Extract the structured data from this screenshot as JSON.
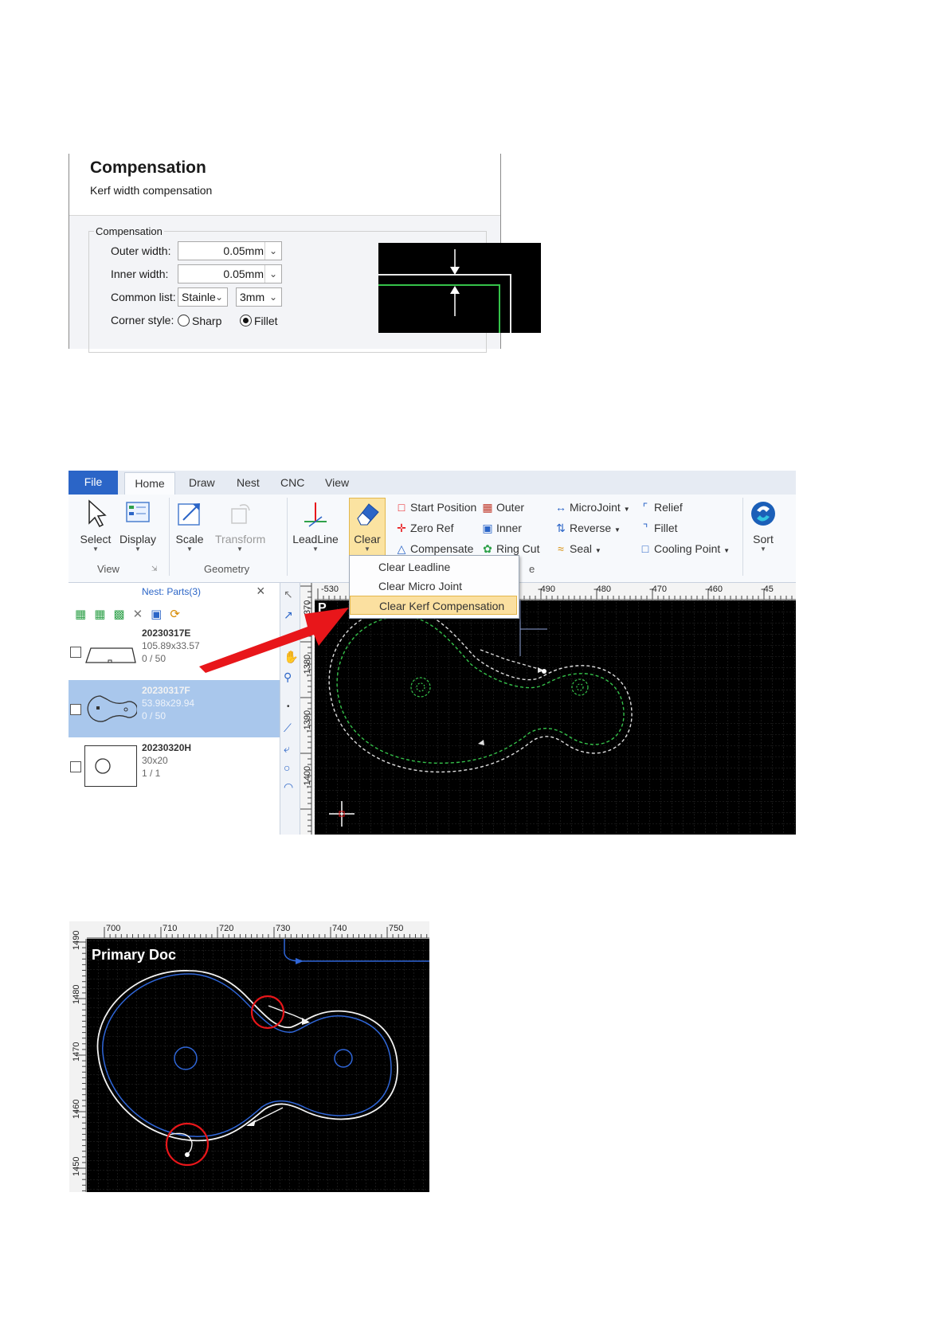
{
  "compensation": {
    "title": "Compensation",
    "subtitle": "Kerf width compensation",
    "group_label": "Compensation",
    "outer_width_label": "Outer width:",
    "outer_width_value": "0.05mm",
    "inner_width_label": "Inner width:",
    "inner_width_value": "0.05mm",
    "common_list_label": "Common list:",
    "material_value": "Stainle",
    "thickness_value": "3mm",
    "corner_style_label": "Corner style:",
    "corner_sharp_label": "Sharp",
    "corner_fillet_label": "Fillet",
    "corner_selected": "Fillet"
  },
  "ribbon": {
    "tabs": [
      "File",
      "Home",
      "Draw",
      "Nest",
      "CNC",
      "View"
    ],
    "active_tab": "Home",
    "view_group": {
      "label": "View",
      "select": "Select",
      "display": "Display"
    },
    "geometry_group": {
      "label": "Geometry",
      "scale": "Scale",
      "transform": "Transform"
    },
    "leadline": "LeadLine",
    "clear": "Clear",
    "tools": {
      "start_position": "Start Position",
      "zero_ref": "Zero Ref",
      "compensate": "Compensate",
      "outer": "Outer",
      "inner": "Inner",
      "ring_cut": "Ring Cut",
      "microjoint": "MicroJoint",
      "reverse": "Reverse",
      "seal": "Seal",
      "relief": "Relief",
      "fillet": "Fillet",
      "cooling_point": "Cooling Point",
      "group_label_fragment": "e"
    },
    "sort": "Sort"
  },
  "clear_menu": {
    "items": [
      "Clear Leadline",
      "Clear Micro Joint",
      "Clear Kerf Compensation"
    ],
    "highlighted": "Clear Kerf Compensation"
  },
  "nest_panel": {
    "title": "Nest: Parts(3)",
    "parts": [
      {
        "name": "20230317E",
        "size": "105.89x33.57",
        "count": "0 / 50"
      },
      {
        "name": "20230317F",
        "size": "53.98x29.94",
        "count": "0 / 50",
        "selected": true
      },
      {
        "name": "20230320H",
        "size": "30x20",
        "count": "1 / 1"
      }
    ]
  },
  "canvas_rulers": {
    "h_ticks": [
      "-530",
      "-490",
      "-480",
      "-470",
      "-460",
      "-45"
    ],
    "v_ticks": [
      "-1380",
      "-1390",
      "-1400",
      "370"
    ],
    "doc_fragment": "P"
  },
  "primary_doc": {
    "title": "Primary Doc",
    "h_ticks": [
      "700",
      "710",
      "720",
      "730",
      "740",
      "750"
    ],
    "v_ticks": [
      "1490",
      "1480",
      "1470",
      "1460",
      "1450"
    ]
  },
  "colors": {
    "ribbon_accent": "#2b65c7",
    "menu_highlight": "#fbe0a0",
    "arrow_red": "#e8161a",
    "selected_row": "#a9c7ec",
    "path_blue": "#2f66d8",
    "compensation_green": "#35c24a"
  }
}
